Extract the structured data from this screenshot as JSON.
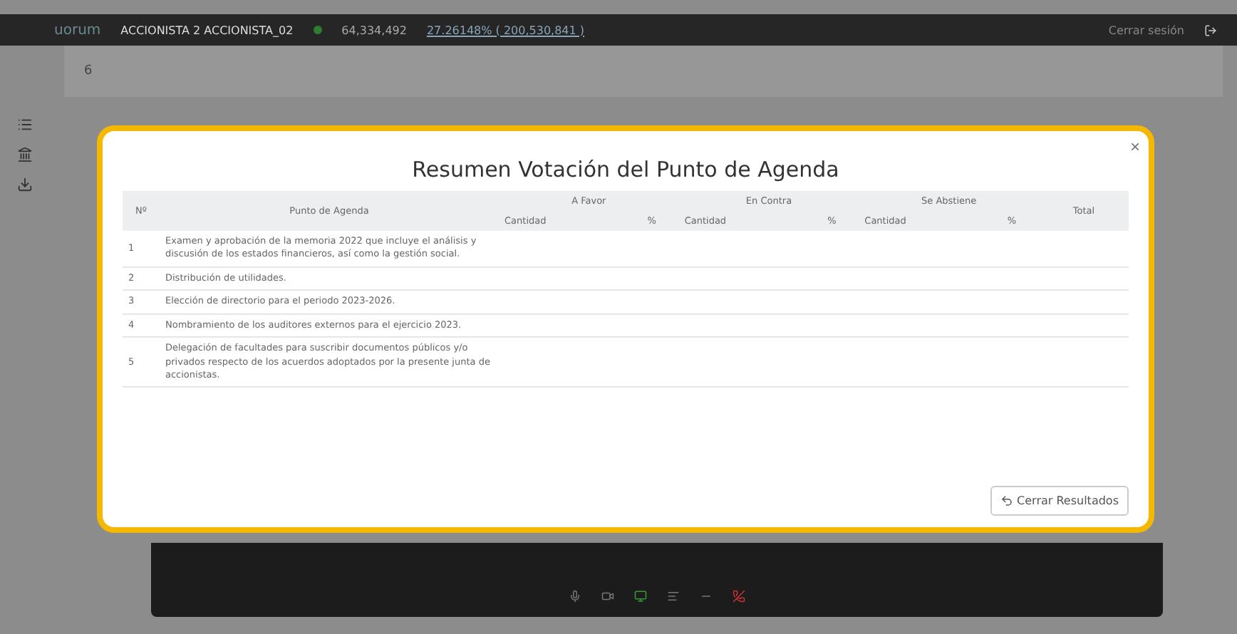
{
  "topbar": {
    "logo": "uorum",
    "shareholder": "ACCIONISTA 2 ACCIONISTA_02",
    "shares": "64,334,492",
    "percent": "27.26148% ( 200,530,841 )",
    "logout": "Cerrar sesión"
  },
  "agenda_header": {
    "number": "6"
  },
  "modal": {
    "title": "Resumen Votación del Punto de Agenda",
    "close": "×",
    "columns": {
      "number": "Nº",
      "item": "Punto de Agenda",
      "groups": [
        {
          "label": "A Favor",
          "quantity": "Cantidad",
          "percent": "%"
        },
        {
          "label": "En Contra",
          "quantity": "Cantidad",
          "percent": "%"
        },
        {
          "label": "Se Abstiene",
          "quantity": "Cantidad",
          "percent": "%"
        }
      ],
      "total": "Total"
    },
    "rows": [
      {
        "number": "1",
        "item": "Examen y aprobación de la memoria 2022 que incluye el análisis y discusión de los estados financieros, así como la gestión social."
      },
      {
        "number": "2",
        "item": "Distribución de utilidades."
      },
      {
        "number": "3",
        "item": "Elección de directorio para el periodo 2023-2026."
      },
      {
        "number": "4",
        "item": "Nombramiento de los auditores externos para el ejercicio 2023."
      },
      {
        "number": "5",
        "item": "Delegación de facultades para suscribir documentos públicos y/o privados respecto de los acuerdos adoptados por la presente junta de accionistas."
      }
    ],
    "button": "Cerrar Resultados"
  }
}
